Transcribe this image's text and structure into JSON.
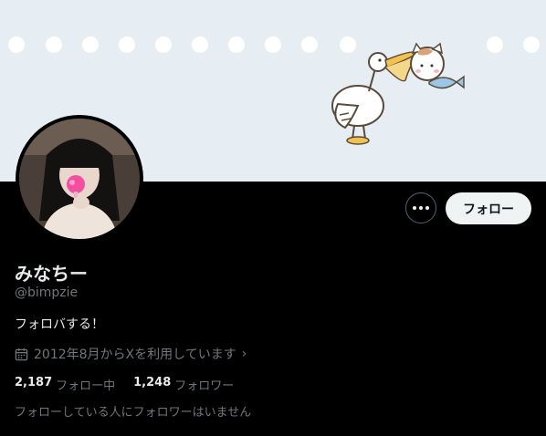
{
  "profile": {
    "display_name": "みなちー",
    "handle": "@bimpzie",
    "bio": "フォロバする！",
    "joined": "2012年8月からXを利用しています",
    "following_count": "2,187",
    "following_label": "フォロー中",
    "followers_count": "1,248",
    "followers_label": "フォロワー",
    "mutuals_note": "フォローしている人にフォロワーはいません"
  },
  "actions": {
    "follow_label": "フォロー",
    "more_icon": "more-horizontal-icon"
  },
  "colors": {
    "background": "#000000",
    "banner": "#e6eef4",
    "follow_button_bg": "#eff3f4",
    "secondary_text": "#71767b"
  }
}
